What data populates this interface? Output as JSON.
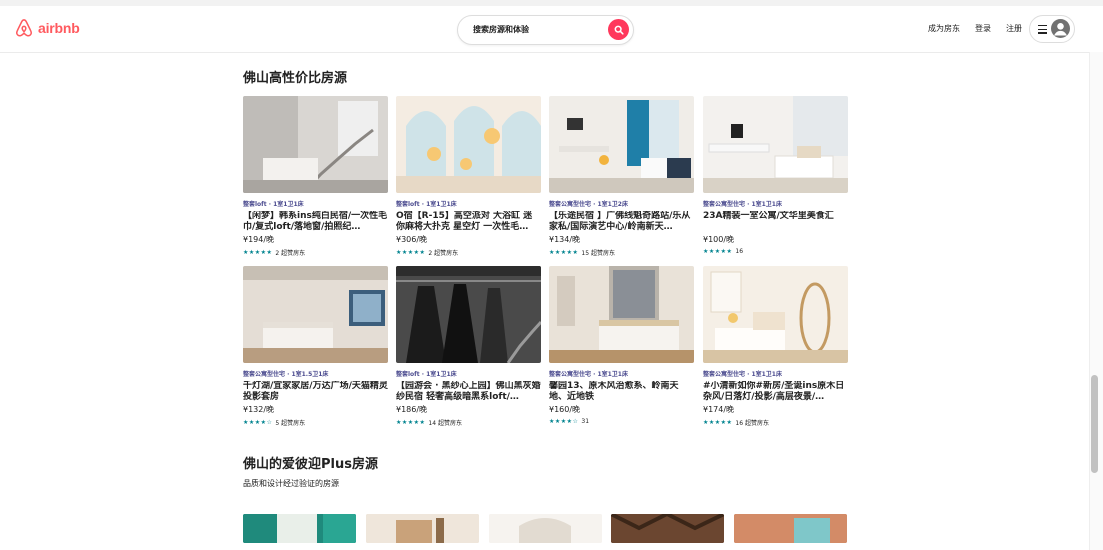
{
  "header": {
    "logo_text": "airbnb",
    "search_label": "搜索房源和体验",
    "nav": {
      "host": "成为房东",
      "login": "登录",
      "signup": "注册"
    }
  },
  "section1": {
    "title": "佛山高性价比房源",
    "cards": [
      {
        "meta": "整套loft · 1室1卫1床",
        "title": "【闲梦】韩系ins纯白民宿/一次性毛巾/复式loft/落地窗/拍照纪…",
        "price": "¥194/晚",
        "stars": "★★★★★",
        "rating": "2 超赞房东"
      },
      {
        "meta": "整套loft · 1室1卫1床",
        "title": "O宿【R-15】高空派对 大浴缸 迷你麻将大扑克 星空灯 一次性毛…",
        "price": "¥306/晚",
        "stars": "★★★★★",
        "rating": "2 超赞房东"
      },
      {
        "meta": "整套公寓型住宅 · 1室1卫2床",
        "title": "【乐途民宿 】广佛线魁奇路站/乐从家私/国际演艺中心/岭南新天…",
        "price": "¥134/晚",
        "stars": "★★★★★",
        "rating": "15 超赞房东"
      },
      {
        "meta": "整套公寓型住宅 · 1室1卫1床",
        "title": "23A精装一室公寓/文华里美食汇",
        "price": "¥100/晚",
        "stars": "★★★★★",
        "rating": "16"
      },
      {
        "meta": "整套公寓型住宅 · 1室1.5卫1床",
        "title": "千灯湖/宜家家居/万达广场/天猫精灵投影套房",
        "price": "¥132/晚",
        "stars": "★★★★☆",
        "rating": "5 超赞房东"
      },
      {
        "meta": "整套loft · 1室1卫1床",
        "title": "【园游会 · 黑纱心上园】佛山黑灰婚纱民宿 轻奢高级暗黑系loft/…",
        "price": "¥186/晚",
        "stars": "★★★★★",
        "rating": "14 超赞房东"
      },
      {
        "meta": "整套公寓型住宅 · 1室1卫1床",
        "title": "馨园13、原木风治愈系、岭南天地、近地铁",
        "price": "¥160/晚",
        "stars": "★★★★☆",
        "rating": "31"
      },
      {
        "meta": "整套公寓型住宅 · 1室1卫1床",
        "title": "#小清新如你#新房/圣诞ins原木日杂风/日落灯/投影/高层夜景/…",
        "price": "¥174/晚",
        "stars": "★★★★★",
        "rating": "16 超赞房东"
      }
    ]
  },
  "section2": {
    "title": "佛山的爱彼迎Plus房源",
    "subtitle": "品质和设计经过验证的房源",
    "photo_names": [
      "plus-photo-1",
      "plus-photo-2",
      "plus-photo-3",
      "plus-photo-4",
      "plus-photo-5"
    ]
  },
  "colors": {
    "brand": "#FF5A5F",
    "search_button": "#FF385C",
    "stars": "#00838f"
  }
}
